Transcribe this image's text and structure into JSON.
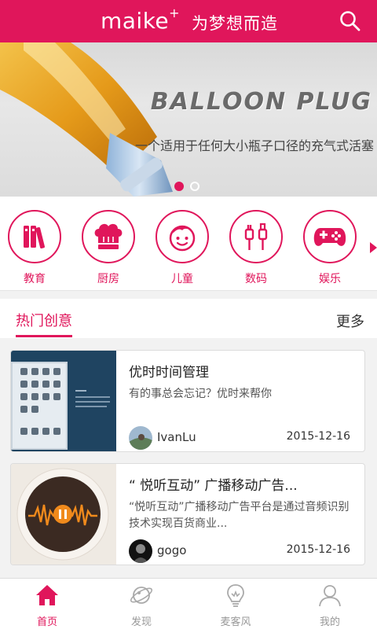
{
  "header": {
    "logo": "maike",
    "logo_plus": "+",
    "slogan": "为梦想而造",
    "search_icon": "search-icon",
    "bg_color": "#e0165b"
  },
  "banner": {
    "title": "BALLOON PLUG",
    "subtitle": "一个适用于任何大小瓶子口径的充气式活塞",
    "slides": 2,
    "active_slide": 1
  },
  "categories": [
    {
      "label": "教育",
      "icon": "books-icon"
    },
    {
      "label": "厨房",
      "icon": "chef-hat-icon"
    },
    {
      "label": "儿童",
      "icon": "child-face-icon"
    },
    {
      "label": "数码",
      "icon": "cables-icon"
    },
    {
      "label": "娱乐",
      "icon": "gamepad-icon"
    }
  ],
  "section": {
    "title": "热门创意",
    "more": "更多"
  },
  "cards": [
    {
      "title": "优时时间管理",
      "desc": "有的事总会忘记？优时来帮你",
      "author": "IvanLu",
      "date": "2015-12-16"
    },
    {
      "title": "“ 悦听互动” 广播移动广告...",
      "desc": "“悦听互动”广播移动广告平台是通过音频识别技术实现百货商业...",
      "author": "gogo",
      "date": "2015-12-16"
    }
  ],
  "tabs": [
    {
      "label": "首页",
      "icon": "home-icon",
      "active": true
    },
    {
      "label": "发现",
      "icon": "planet-icon",
      "active": false
    },
    {
      "label": "麦客风",
      "icon": "bulb-icon",
      "active": false
    },
    {
      "label": "我的",
      "icon": "user-icon",
      "active": false
    }
  ],
  "accent": "#e0165b"
}
